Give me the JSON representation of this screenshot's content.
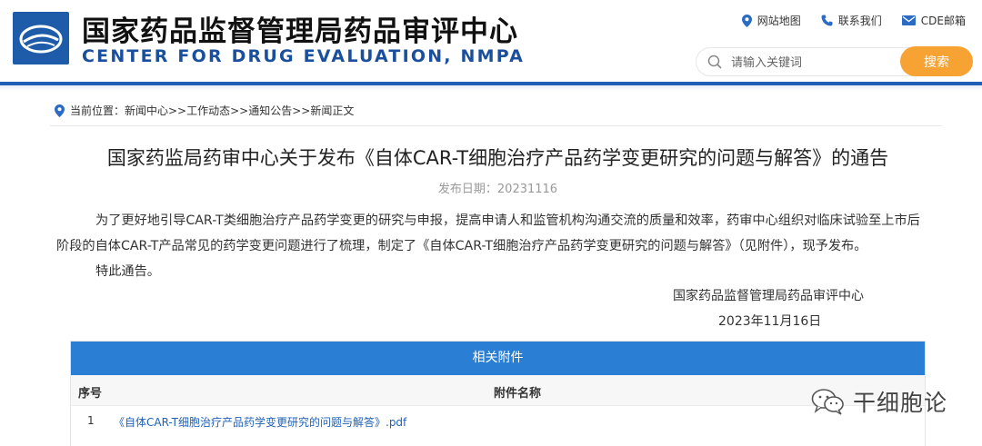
{
  "header": {
    "title_cn": "国家药品监督管理局药品审评中心",
    "title_en": "CENTER FOR DRUG EVALUATION, NMPA",
    "links": [
      {
        "label": "网站地图",
        "icon": "location-pin-icon"
      },
      {
        "label": "联系我们",
        "icon": "phone-icon"
      },
      {
        "label": "CDE邮箱",
        "icon": "mail-icon"
      }
    ],
    "search_placeholder": "请输入关键词",
    "search_button": "搜索"
  },
  "breadcrumb": "当前位置：新闻中心>>工作动态>>通知公告>>新闻正文",
  "article": {
    "title": "国家药监局药审中心关于发布《自体CAR-T细胞治疗产品药学变更研究的问题与解答》的通告",
    "date_label": "发布日期：20231116",
    "para1_line1": "为了更好地引导CAR-T类细胞治疗产品药学变更的研究与申报，提高申请人和监管机构沟通交流的质量和效率，药审中心组织对临床试验至上市后",
    "para1_line2": "阶段的自体CAR-T产品常见的药学变更问题进行了梳理，制定了《自体CAR-T细胞治疗产品药学变更研究的问题与解答》（见附件），现予发布。",
    "para2": "特此通告。",
    "sign_org": "国家药品监督管理局药品审评中心",
    "sign_date": "2023年11月16日"
  },
  "attachments": {
    "header": "相关附件",
    "col_no": "序号",
    "col_name": "附件名称",
    "rows": [
      {
        "no": "1",
        "name": "《自体CAR-T细胞治疗产品药学变更研究的问题与解答》.pdf"
      }
    ]
  },
  "watermark": {
    "text": "干细胞论"
  },
  "colors": {
    "brand_blue": "#1f5fb5",
    "table_header": "#2a7fd4",
    "search_button": "#f7a334",
    "link": "#2262b6"
  }
}
